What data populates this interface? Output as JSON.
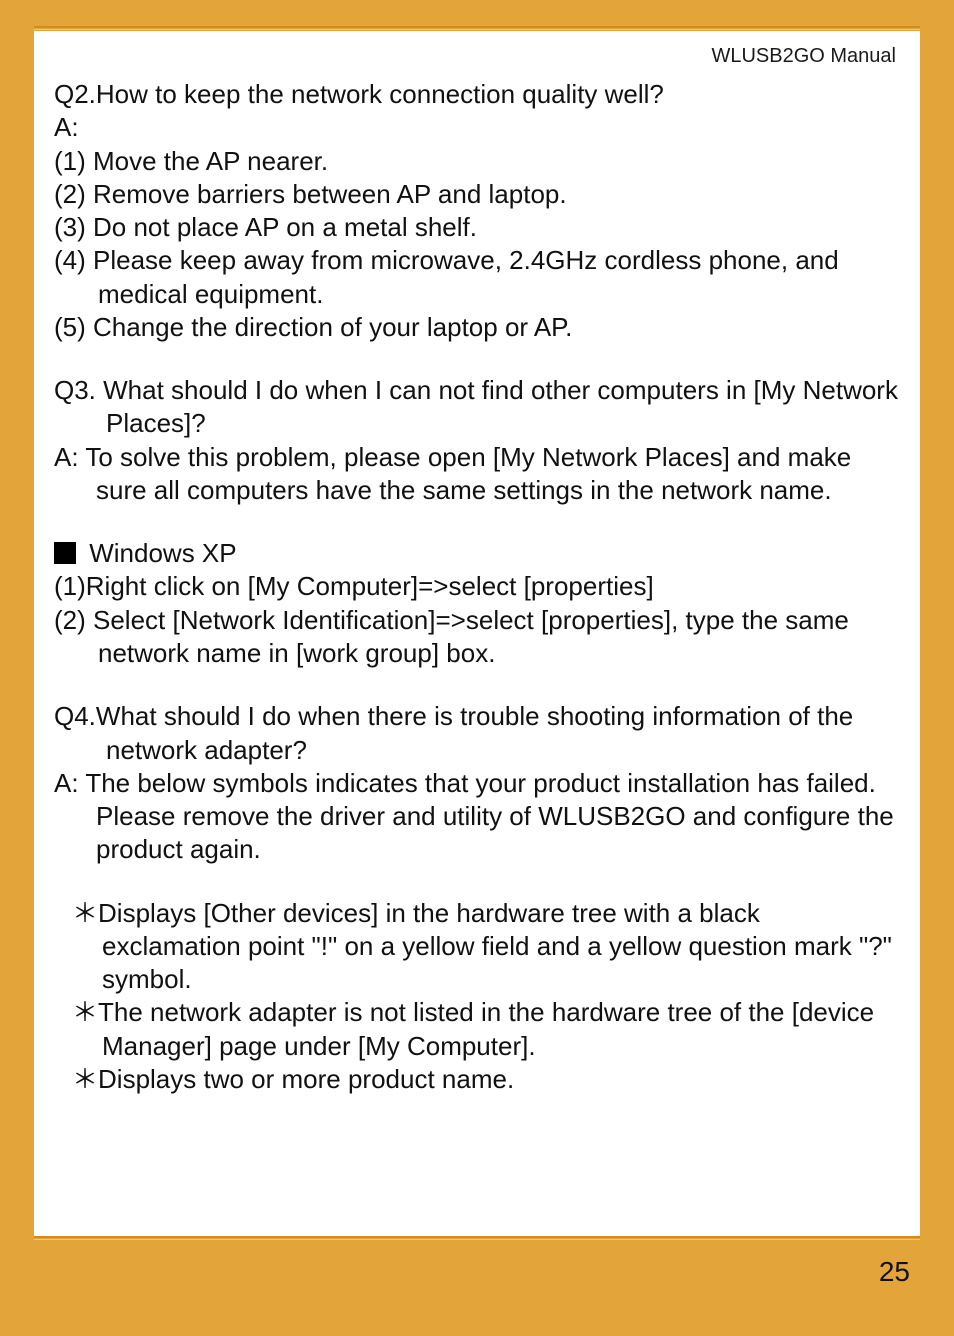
{
  "header": {
    "title": "WLUSB2GO  Manual"
  },
  "page_number": "25",
  "content": {
    "q2": "Q2.How to keep the network connection quality well?",
    "a2_label": "A:",
    "a2_items": [
      "(1) Move the AP nearer.",
      "(2) Remove barriers between AP and laptop.",
      "(3) Do not place AP on a metal shelf.",
      "(4) Please keep away from microwave, 2.4GHz cordless phone, and medical equipment.",
      "(5) Change the direction of your laptop or AP."
    ],
    "q3": "Q3. What should I do when I can not find other computers in [My Network Places]?",
    "a3": "A: To solve this problem, please open [My Network Places] and  make sure all computers have the same settings in the network name.",
    "winxp_label": " Windows XP",
    "winxp_steps": [
      "(1)Right click on [My Computer]=>select [properties]",
      "(2) Select [Network Identification]=>select [properties], type the same network name in [work group] box."
    ],
    "q4": "Q4.What should I do when there is trouble shooting information of the network adapter?",
    "a4": "A: The below symbols indicates that your product installation has failed. Please remove the driver and utility of WLUSB2GO and configure the product again.",
    "a4_bullets": [
      "Displays [Other devices] in the hardware tree with a black exclamation point \"!\"  on a yellow field and a yellow question mark \"?\"  symbol.",
      "The network adapter is not listed in the hardware tree of the [device Manager] page under [My Computer].",
      "Displays two or more product name."
    ]
  }
}
